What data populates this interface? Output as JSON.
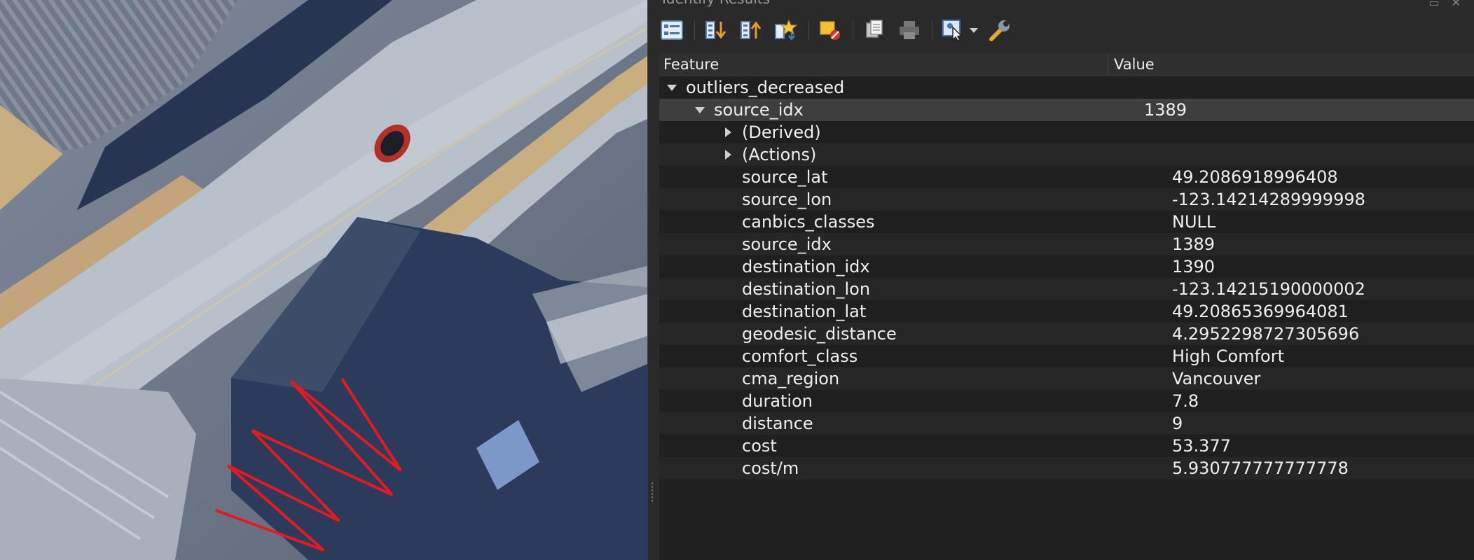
{
  "panel": {
    "title": "Identify Results",
    "title_buttons": "▭ ✕"
  },
  "toolbar": {
    "buttons": [
      {
        "name": "expand-tree-icon"
      },
      {
        "name": "expand-all-icon"
      },
      {
        "name": "collapse-all-icon"
      },
      {
        "name": "expand-new-results-icon"
      },
      {
        "name": "clear-results-icon"
      },
      {
        "name": "copy-feature-icon"
      },
      {
        "name": "print-icon"
      },
      {
        "name": "identify-mode-icon"
      },
      {
        "name": "settings-wrench-icon"
      }
    ]
  },
  "tree": {
    "header": {
      "feature": "Feature",
      "value": "Value"
    },
    "layer": {
      "label": "outliers_decreased"
    },
    "feature": {
      "label": "source_idx",
      "value": "1389"
    },
    "groups": [
      {
        "label": "(Derived)"
      },
      {
        "label": "(Actions)"
      }
    ],
    "attributes": [
      {
        "name": "source_lat",
        "value": "49.2086918996408"
      },
      {
        "name": "source_lon",
        "value": "-123.14214289999998"
      },
      {
        "name": "canbics_classes",
        "value": "NULL"
      },
      {
        "name": "source_idx",
        "value": "1389"
      },
      {
        "name": "destination_idx",
        "value": "1390"
      },
      {
        "name": "destination_lon",
        "value": "-123.14215190000002"
      },
      {
        "name": "destination_lat",
        "value": "49.20865369964081"
      },
      {
        "name": "geodesic_distance",
        "value": "4.2952298727305696"
      },
      {
        "name": "comfort_class",
        "value": "High Comfort"
      },
      {
        "name": "cma_region",
        "value": "Vancouver"
      },
      {
        "name": "duration",
        "value": "7.8"
      },
      {
        "name": "distance",
        "value": "9"
      },
      {
        "name": "cost",
        "value": "53.377"
      },
      {
        "name": "cost/m",
        "value": "5.930777777777778"
      }
    ]
  },
  "map": {
    "route_color": "#e8191c"
  }
}
